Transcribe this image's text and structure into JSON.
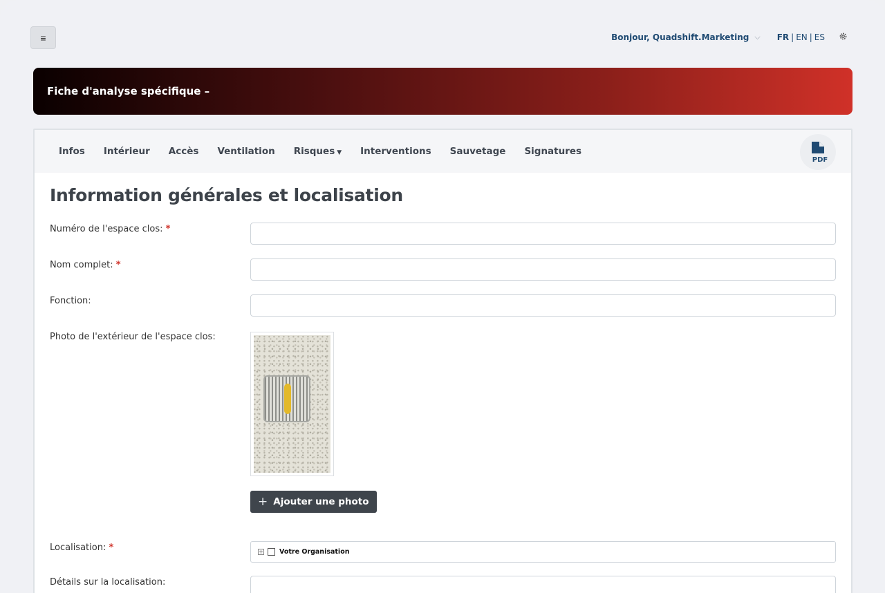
{
  "header": {
    "menu_icon": "hamburger-icon",
    "greeting": "Bonjour, Quadshift.Marketing",
    "languages": [
      "FR",
      "EN",
      "ES"
    ],
    "active_language": "FR",
    "settings_icon": "gear-icon"
  },
  "banner": {
    "title": "Fiche d'analyse spécifique –",
    "gradient_start": "#0a0000",
    "gradient_end": "#d03128"
  },
  "tabs": [
    {
      "label": "Infos"
    },
    {
      "label": "Intérieur"
    },
    {
      "label": "Accès"
    },
    {
      "label": "Ventilation"
    },
    {
      "label": "Risques",
      "dropdown": true
    },
    {
      "label": "Interventions"
    },
    {
      "label": "Sauvetage"
    },
    {
      "label": "Signatures"
    }
  ],
  "pdf_button": {
    "icon": "pdf-icon",
    "text": "PDF"
  },
  "form": {
    "title": "Information générales et localisation",
    "fields": {
      "numero": {
        "label": "Numéro de l'espace clos:",
        "required": "*",
        "value": ""
      },
      "nom": {
        "label": "Nom complet:",
        "required": "*",
        "value": ""
      },
      "fonction": {
        "label": "Fonction:",
        "value": ""
      },
      "photo": {
        "label": "Photo de l'extérieur de l'espace clos:",
        "add_label": "Ajouter une photo"
      },
      "localisation": {
        "label": "Localisation:",
        "required": "*",
        "tree_item": "Votre Organisation"
      },
      "details": {
        "label": "Détails sur la localisation:",
        "value": ""
      }
    }
  }
}
